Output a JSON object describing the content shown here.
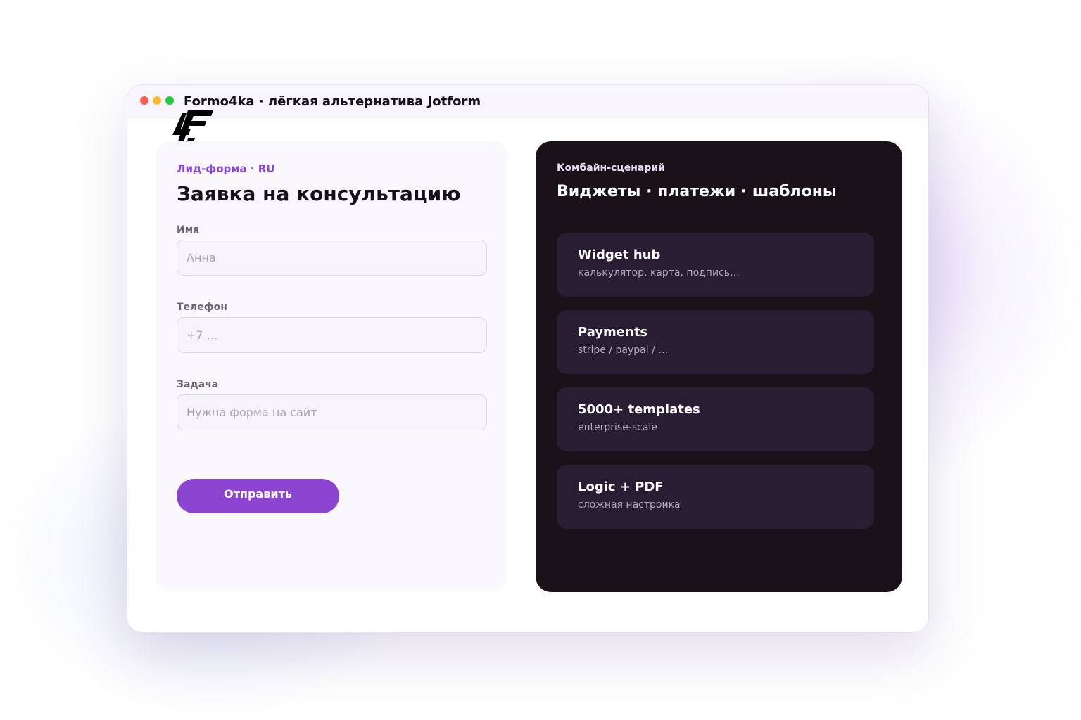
{
  "window": {
    "title": "Formo4ka · лёгкая альтернатива Jotform",
    "logo_icon": "formo4ka-logo"
  },
  "form": {
    "kicker": "Лид-форма · RU",
    "heading": "Заявка на консультацию",
    "fields": [
      {
        "label": "Имя",
        "placeholder": "Анна",
        "value": ""
      },
      {
        "label": "Телефон",
        "placeholder": "+7 …",
        "value": ""
      },
      {
        "label": "Задача",
        "placeholder": "Нужна форма на сайт",
        "value": ""
      }
    ],
    "submit_label": "Отправить"
  },
  "panel": {
    "kicker": "Комбайн-сценарий",
    "heading": "Виджеты · платежи · шаблоны",
    "features": [
      {
        "title": "Widget hub",
        "desc": "калькулятор, карта, подпись…"
      },
      {
        "title": "Payments",
        "desc": "stripe / paypal / …"
      },
      {
        "title": "5000+ templates",
        "desc": "enterprise-scale"
      },
      {
        "title": "Logic + PDF",
        "desc": "сложная настройка"
      }
    ]
  },
  "colors": {
    "accent": "#8a44d0",
    "dark_panel": "#1b1118",
    "feature_card": "#281d33",
    "form_card": "#faf7fd"
  }
}
